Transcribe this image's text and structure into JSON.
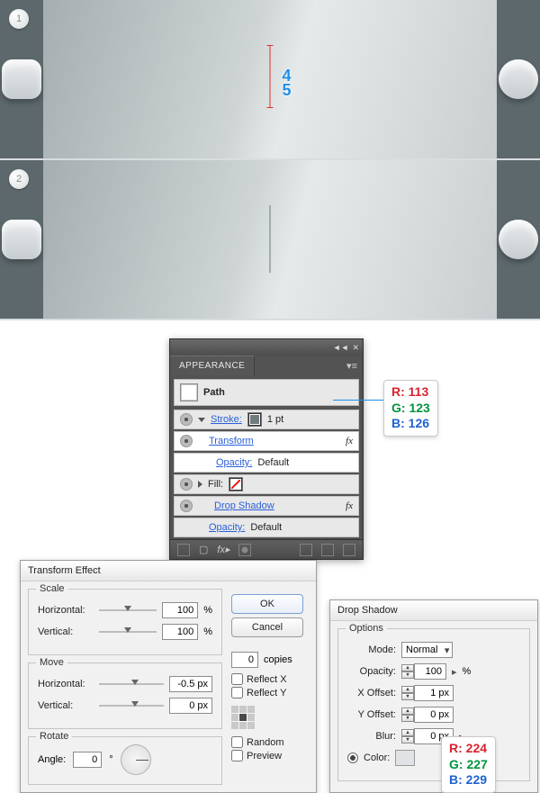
{
  "strips": {
    "badge1": "1",
    "badge2": "2",
    "measure": "45"
  },
  "appearance": {
    "tab": "APPEARANCE",
    "path": "Path",
    "stroke": "Stroke:",
    "stroke_weight": "1 pt",
    "transform": "Transform",
    "opacity": "Opacity:",
    "opacity_val": "Default",
    "fill": "Fill:",
    "dropshadow": "Drop Shadow"
  },
  "rgb_stroke": {
    "r": "R: 113",
    "g": "G: 123",
    "b": "B: 126"
  },
  "rgb_ds": {
    "r": "R: 224",
    "g": "G: 227",
    "b": "B: 229"
  },
  "transform": {
    "title": "Transform Effect",
    "scale": "Scale",
    "horizontal": "Horizontal:",
    "vertical": "Vertical:",
    "scale_h": "100",
    "scale_v": "100",
    "pct": "%",
    "move": "Move",
    "move_h": "-0.5 px",
    "move_v": "0 px",
    "rotate": "Rotate",
    "angle": "Angle:",
    "angle_v": "0",
    "deg": "°",
    "ok": "OK",
    "cancel": "Cancel",
    "copies_v": "0",
    "copies": "copies",
    "reflectx": "Reflect X",
    "reflecty": "Reflect Y",
    "random": "Random",
    "preview": "Preview"
  },
  "ds": {
    "title": "Drop Shadow",
    "options": "Options",
    "mode": "Mode:",
    "mode_v": "Normal",
    "opacity": "Opacity:",
    "opacity_v": "100",
    "pct": "%",
    "xoff": "X Offset:",
    "xoff_v": "1 px",
    "yoff": "Y Offset:",
    "yoff_v": "0 px",
    "blur": "Blur:",
    "blur_v": "0 px",
    "color": "Color:"
  }
}
